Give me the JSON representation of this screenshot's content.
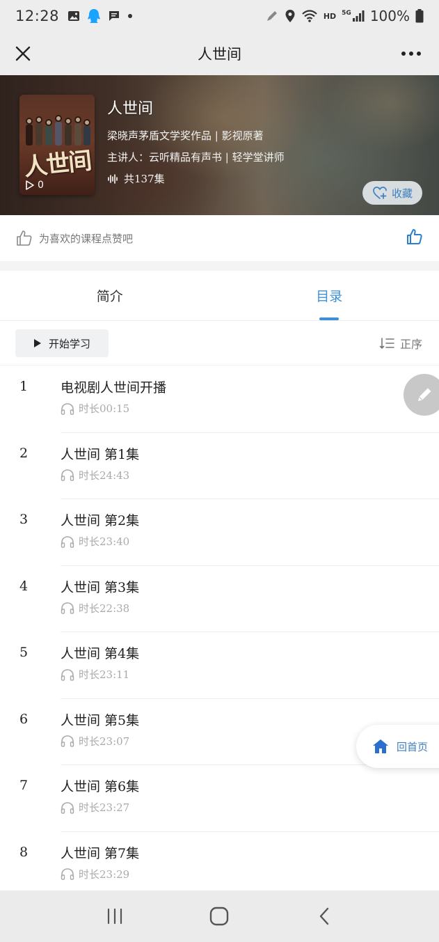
{
  "status_bar": {
    "time": "12:28",
    "network_hd": "HD",
    "network_5g": "5G",
    "battery": "100%"
  },
  "header": {
    "title": "人世间"
  },
  "course": {
    "title": "人世间",
    "subtitle": "梁晓声茅盾文学奖作品 | 影视原著",
    "lecturer": "主讲人：云听精品有声书 | 轻学堂讲师",
    "episodes": "共137集",
    "play_count": "0",
    "cover_text": "人世间",
    "favorite_label": "收藏"
  },
  "like_row": {
    "text": "为喜欢的课程点赞吧"
  },
  "tabs": [
    {
      "label": "简介",
      "active": false
    },
    {
      "label": "目录",
      "active": true
    }
  ],
  "toolbar": {
    "start_label": "开始学习",
    "sort_label": "正序"
  },
  "episodes": [
    {
      "num": "1",
      "title": "电视剧人世间开播",
      "duration": "时长00:15"
    },
    {
      "num": "2",
      "title": "人世间 第1集",
      "duration": "时长24:43"
    },
    {
      "num": "3",
      "title": "人世间 第2集",
      "duration": "时长23:40"
    },
    {
      "num": "4",
      "title": "人世间 第3集",
      "duration": "时长22:38"
    },
    {
      "num": "5",
      "title": "人世间 第4集",
      "duration": "时长23:11"
    },
    {
      "num": "6",
      "title": "人世间 第5集",
      "duration": "时长23:07"
    },
    {
      "num": "7",
      "title": "人世间 第6集",
      "duration": "时长23:27"
    },
    {
      "num": "8",
      "title": "人世间 第7集",
      "duration": "时长23:29"
    }
  ],
  "home_button": {
    "label": "回首页"
  },
  "colors": {
    "accent": "#3d8fd6",
    "link": "#3d7fbf",
    "muted": "#aaaaaa"
  },
  "icons": {
    "close": "close-icon",
    "more": "more-icon",
    "like": "thumbs-up-icon",
    "play": "play-icon",
    "sort": "sort-icon",
    "headphones": "headphones-icon",
    "edit": "pencil-icon",
    "home": "home-icon",
    "heart": "heart-plus-icon"
  }
}
